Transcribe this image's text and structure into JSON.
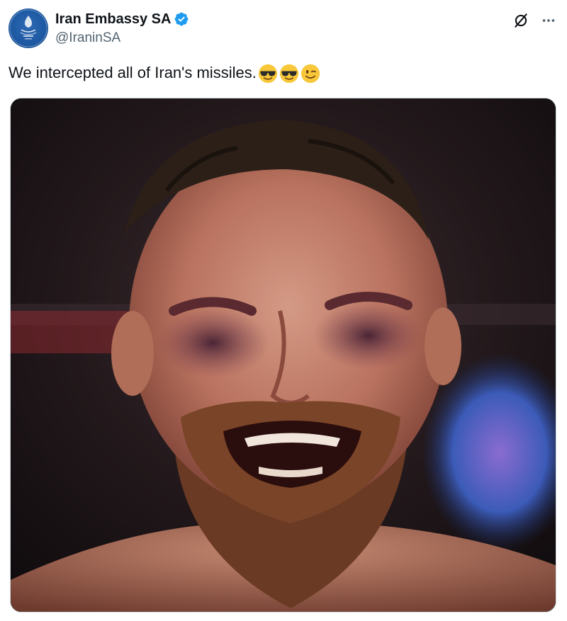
{
  "author": {
    "display_name": "Iran Embassy SA",
    "handle": "@IraninSA",
    "verified": true,
    "avatar_icon": "embassy-emblem-icon"
  },
  "actions": {
    "grok_icon": "grok-icon",
    "more_icon": "more-options-icon"
  },
  "tweet": {
    "text": "We intercepted all of Iran's missiles.",
    "emojis": [
      "smiling-face-with-sunglasses",
      "smiling-face-with-sunglasses",
      "winking-face"
    ]
  },
  "media": {
    "type": "photo",
    "subject": "bruised bearded fighter laughing"
  },
  "colors": {
    "text": "#0f1419",
    "secondary": "#536471",
    "verified": "#1d9bf0",
    "border": "#cfd9de"
  }
}
